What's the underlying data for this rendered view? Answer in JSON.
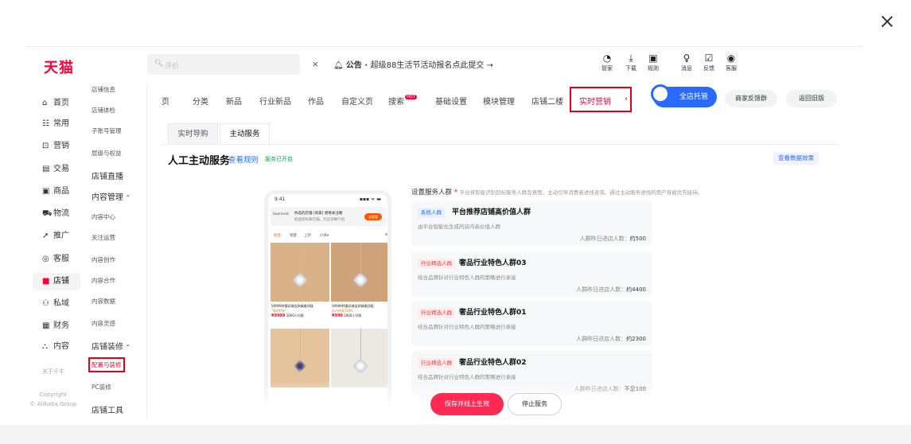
{
  "modal": {
    "close_label": "×"
  },
  "header": {
    "logo": "天猫",
    "search_placeholder": "评价",
    "clear_icon": "×",
    "notice_prefix": "公告 · ",
    "notice_text": "超级88生活节活动报名点此提交 →",
    "icons": [
      {
        "name": "guanjia",
        "label": "管家",
        "glyph": "◔"
      },
      {
        "name": "download",
        "label": "下载",
        "glyph": "⤓"
      },
      {
        "name": "rules",
        "label": "规则",
        "glyph": "▣"
      },
      {
        "name": "message",
        "label": "消息",
        "glyph": "♀"
      },
      {
        "name": "feedback",
        "label": "反馈",
        "glyph": "☑"
      },
      {
        "name": "guard",
        "label": "客服",
        "glyph": "◉"
      }
    ]
  },
  "sidebar_main": {
    "items": [
      {
        "key": "home",
        "icon": "⌂",
        "label": "首页"
      },
      {
        "key": "common",
        "icon": "☷",
        "label": "常用"
      },
      {
        "key": "marketing",
        "icon": "⊡",
        "label": "营销"
      },
      {
        "key": "trade",
        "icon": "▤",
        "label": "交易"
      },
      {
        "key": "goods",
        "icon": "▣",
        "label": "商品"
      },
      {
        "key": "logistics",
        "icon": "⛟",
        "label": "物流"
      },
      {
        "key": "promote",
        "icon": "➚",
        "label": "推广"
      },
      {
        "key": "service",
        "icon": "◎",
        "label": "客服"
      },
      {
        "key": "shop",
        "icon": "■",
        "label": "店铺"
      },
      {
        "key": "private",
        "icon": "⚇",
        "label": "私域"
      },
      {
        "key": "finance",
        "icon": "▦",
        "label": "财务"
      },
      {
        "key": "content",
        "icon": "⛬",
        "label": "内容"
      }
    ],
    "about": "关于千牛",
    "copyright_1": "Copyright",
    "copyright_2": "© Alibaba Group"
  },
  "sidebar_sub": {
    "items": [
      "店铺信息",
      "店铺体检",
      "子账号管理",
      "层级与权益",
      "店铺直播",
      "内容管理",
      "内容中心",
      "关注运营",
      "内容创作",
      "内容合作",
      "内容数据",
      "内容灵感",
      "店铺装修",
      "配置与装修",
      "PC装修",
      "店铺工具"
    ],
    "caret": "⌃"
  },
  "tabs": {
    "items": [
      "页",
      "分类",
      "新品",
      "行业新品",
      "作品",
      "自定义页",
      "搜索",
      "基础设置",
      "模块管理",
      "店铺二楼",
      "实时营销",
      "‹"
    ],
    "hot": "HOT",
    "active_index": 10
  },
  "top_buttons": {
    "full_service": "全店托管",
    "merchant_feedback": "商家反馈群",
    "back_old": "返回旧版"
  },
  "subtabs": [
    "实时导购",
    "主动服务"
  ],
  "section": {
    "title": "人工主动服务",
    "rules_link": "查看规则",
    "status": "服务已开启",
    "view_data": "查看数据效果"
  },
  "phone": {
    "time": "9:41",
    "signal": "▪▪▪ ᯤ ▬",
    "msg_title": "你选的店铺 [商家] 想要关注喔",
    "msg_sub": "能直接私聊店铺，为您详细介绍",
    "msg_avatar": "Swarovski",
    "msg_go": "去看看",
    "menu": [
      "综合",
      "销量",
      "上新",
      "价格▾",
      "⊞"
    ],
    "products": [
      {
        "title": "S9999特惠珍珠女款精美项链",
        "sub": "\"限时特价\"",
        "price": "¥9999",
        "sold": "2000人付款"
      },
      {
        "title": "S9999特惠珍珠女款精美项链",
        "sub": "店内热卖TOP1",
        "price": "¥999",
        "sold": "2000人付款"
      }
    ]
  },
  "crowd": {
    "heading": "设置服务人群",
    "required": "*",
    "hint": "平台将智能识别目标服务人群及意图，主动引导消费者进线咨询。通过主动服务进线的用户将被优先接待。",
    "cards": [
      {
        "tag": "系统人群",
        "tag_type": "sys",
        "name": "平台推荐店铺高价值人群",
        "desc": "由平台智能化生成的店内高价值人群",
        "count_label": "人群昨日进店人数：",
        "count": "约500"
      },
      {
        "tag": "行业精选人群",
        "tag_type": "ind",
        "name": "奢品行业特色人群03",
        "desc": "结合品牌针对行业特色人群的策略进行承接",
        "count_label": "人群昨日进店人数：",
        "count": "约4400"
      },
      {
        "tag": "行业精选人群",
        "tag_type": "ind",
        "name": "奢品行业特色人群01",
        "desc": "结合品牌针对行业特色人群的策略进行承接",
        "count_label": "人群昨日进店人数：",
        "count": "约2300"
      },
      {
        "tag": "行业精选人群",
        "tag_type": "ind",
        "name": "奢品行业特色人群02",
        "desc": "结合品牌针对行业特色人群的策略进行承接",
        "count_label": "人群昨日进店人数：",
        "count": "不足100"
      }
    ]
  },
  "footer": {
    "save": "保存并线上生效",
    "stop": "停止服务"
  }
}
